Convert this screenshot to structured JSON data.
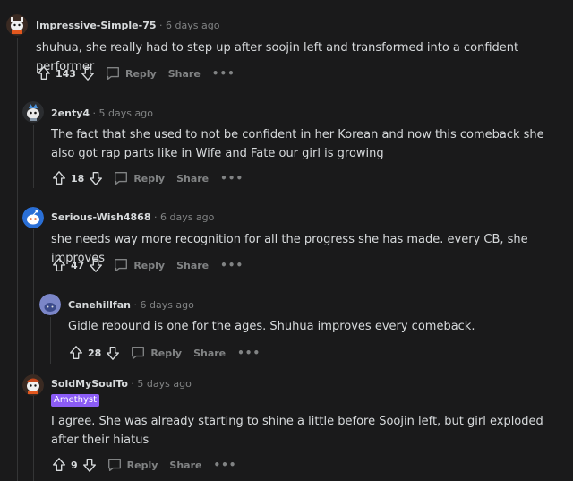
{
  "colors": {
    "background": "#1a1a1b",
    "text": "#d7dadc",
    "muted": "#818384",
    "flair_bg": "#8b5cf6",
    "thread_line": "#343536"
  },
  "labels": {
    "reply": "Reply",
    "share": "Share",
    "more": "•••"
  },
  "comments": [
    {
      "author": "Impressive-Simple-75",
      "time": "· 6 days ago",
      "text": "shuhua, she really had to step up after soojin left and transformed into a confident performer",
      "votes": "143"
    },
    {
      "author": "2enty4",
      "time": "· 5 days ago",
      "text": "The fact that she used to not be confident in her Korean and now this comeback she also got rap parts like in Wife and Fate our girl is growing",
      "votes": "18"
    },
    {
      "author": "Serious-Wish4868",
      "time": "· 6 days ago",
      "text": "she needs way more recognition for all the progress she has made. every CB, she improves",
      "votes": "47"
    },
    {
      "author": "Canehillfan",
      "time": "· 6 days ago",
      "text": "Gidle rebound is one for the ages. Shuhua improves every comeback.",
      "votes": "28"
    },
    {
      "author": "SoldMySoulTo",
      "time": "· 5 days ago",
      "flair": "Amethyst",
      "text": "I agree. She was already starting to shine a little before Soojin left, but girl exploded after their hiatus",
      "votes": "9"
    }
  ]
}
